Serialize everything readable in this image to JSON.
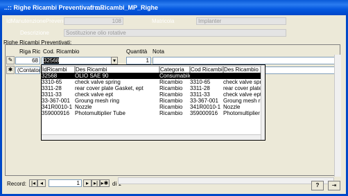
{
  "window": {
    "title_left": "..:: Righe Ricambi Preventivati ::..",
    "title_right": "frmRicambi_MP_Righe"
  },
  "header": {
    "id_label": "IdManutenzionePreventiva",
    "id_value": "108",
    "matricola_label": "Matricola",
    "matricola_value": "Implanter",
    "descrizione_label": "Descrizione",
    "descrizione_value": "Sostituzione olio rotative"
  },
  "subform": {
    "title": "Righe Ricambi Preventivati:",
    "columns": [
      "Riga Ric",
      "Cod. Ricambio",
      "Quantità",
      "Nota"
    ],
    "row1": {
      "riga": "68",
      "cod": "32568",
      "quantita": "1"
    },
    "row2": {
      "riga": "(Contatore)"
    }
  },
  "dropdown": {
    "headers": [
      "IdRicambi",
      "Des Ricambi",
      "Categoria",
      "Cod Ricambi Fi",
      "Des Ricambio For"
    ],
    "rows": [
      [
        "32568",
        "OLIO SAE 90",
        "Consumabile",
        "",
        ""
      ],
      [
        "3310-65",
        "check valve spring",
        "Ricambio",
        "3310-65",
        "check valve spring"
      ],
      [
        "3311-28",
        "rear cover plate Gasket, ept",
        "Ricambio",
        "3311-28",
        "rear cover plate Gasket, ept"
      ],
      [
        "3311-33",
        "check valve ept",
        "Ricambio",
        "3311-33",
        "check valve ept"
      ],
      [
        "33-367-001",
        "Groung mesh ring",
        "Ricambio",
        "33-367-001",
        "Groung mesh ring"
      ],
      [
        "341R0010-1",
        "Nozzle",
        "Ricambio",
        "341R0010-1",
        "Nozzle"
      ],
      [
        "359000916",
        "Photomultiplier Tube",
        "Ricambio",
        "359000916",
        "Photomultiplier Tube"
      ]
    ]
  },
  "navigator": {
    "label": "Record:",
    "current": "1",
    "total": "di 1"
  }
}
